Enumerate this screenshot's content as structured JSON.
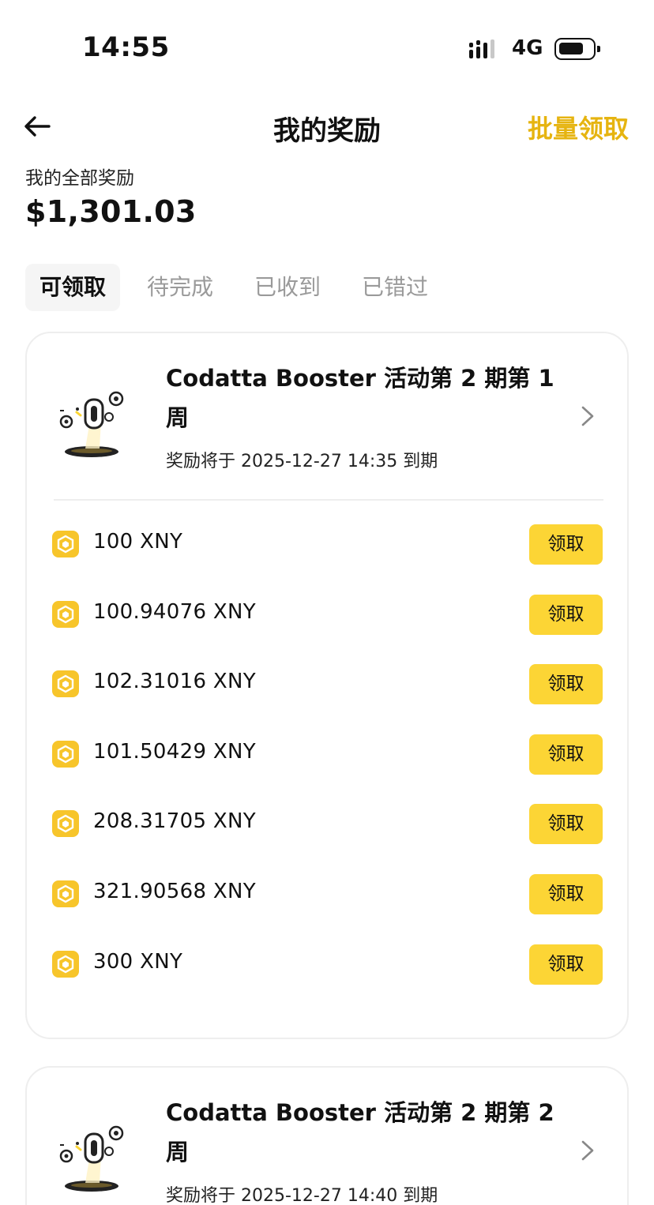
{
  "status_bar": {
    "time": "14:55",
    "network": "4G"
  },
  "header": {
    "title": "我的奖励",
    "batch_claim_label": "批量领取"
  },
  "summary": {
    "label": "我的全部奖励",
    "total": "$1,301.03"
  },
  "tabs": [
    {
      "label": "可领取",
      "active": true
    },
    {
      "label": "待完成",
      "active": false
    },
    {
      "label": "已收到",
      "active": false
    },
    {
      "label": "已错过",
      "active": false
    }
  ],
  "colors": {
    "accent": "#FCD535",
    "accent_text": "#E6B410"
  },
  "cards": [
    {
      "title": "Codatta Booster 活动第 2 期第 1 周",
      "expiry": "奖励将于 2025-12-27 14:35 到期",
      "rewards": [
        {
          "amount": "100 XNY",
          "button": "领取"
        },
        {
          "amount": "100.94076 XNY",
          "button": "领取"
        },
        {
          "amount": "102.31016 XNY",
          "button": "领取"
        },
        {
          "amount": "101.50429 XNY",
          "button": "领取"
        },
        {
          "amount": "208.31705 XNY",
          "button": "领取"
        },
        {
          "amount": "321.90568 XNY",
          "button": "领取"
        },
        {
          "amount": "300 XNY",
          "button": "领取"
        }
      ]
    },
    {
      "title": "Codatta Booster 活动第 2 期第 2 周",
      "expiry": "奖励将于 2025-12-27 14:40 到期"
    }
  ]
}
